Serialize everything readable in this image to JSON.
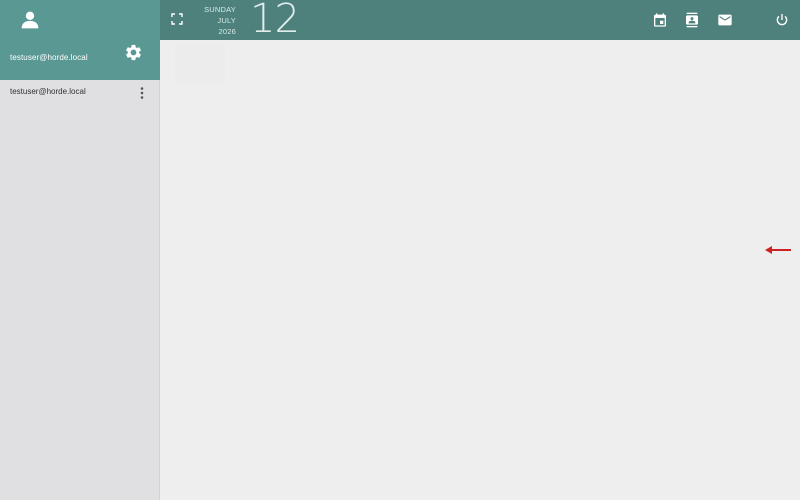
{
  "sidebar": {
    "header_user": "testuser@horde.local",
    "account_label": "testuser@horde.local",
    "icons": {
      "avatar": "person-icon",
      "settings": "gear-icon",
      "menu": "more-vert-icon"
    }
  },
  "topbar": {
    "weekday": "SUNDAY",
    "month": "JULY",
    "year": "2026",
    "day": "12",
    "icons": {
      "fullscreen": "fullscreen-icon",
      "calendar": "calendar-icon",
      "contacts": "contacts-icon",
      "mail": "mail-icon",
      "power": "power-icon"
    }
  },
  "colors": {
    "sidebar_header": "#5a9893",
    "topbar": "#4e807c",
    "sidebar_bg": "#e0dfe1",
    "main_bg": "#eeeeee",
    "arrow": "#cc2222"
  }
}
